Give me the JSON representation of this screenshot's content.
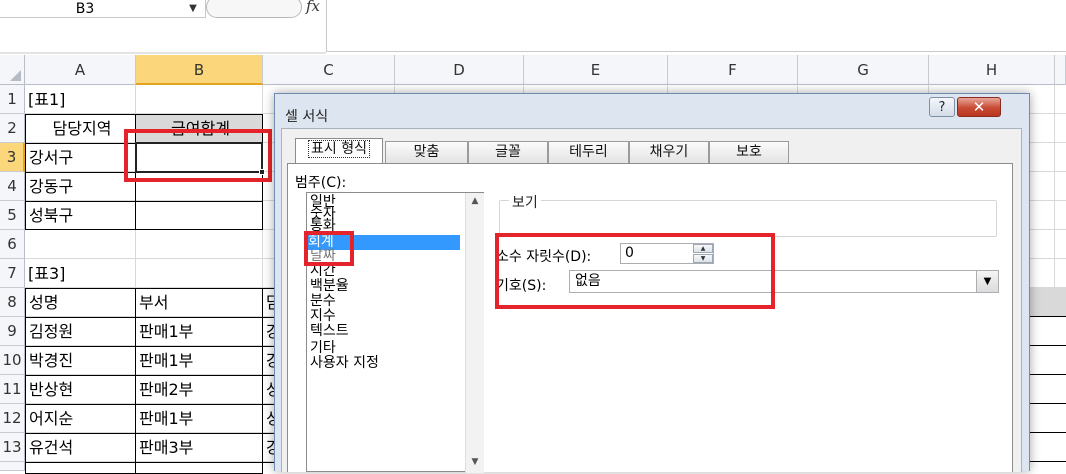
{
  "formula_bar": {
    "name_box": "B3",
    "name_box_arrow": "▼",
    "fx": "fx",
    "value": ""
  },
  "columns": [
    "A",
    "B",
    "C",
    "D",
    "E",
    "F",
    "G",
    "H"
  ],
  "selected_column": "B",
  "rows": [
    "1",
    "2",
    "3",
    "4",
    "5",
    "6",
    "7",
    "8",
    "9",
    "10",
    "11",
    "12",
    "13"
  ],
  "selected_row": "3",
  "cells": {
    "A1": "[표1]",
    "A2": "담당지역",
    "B2": "급여합계",
    "A3": "강서구",
    "A4": "강동구",
    "A5": "성북구",
    "A7": "[표3]",
    "A8": "성명",
    "B8": "부서",
    "A9": "김정원",
    "B9": "판매1부",
    "A10": "박경진",
    "B10": "판매1부",
    "A11": "반상현",
    "B11": "판매2부",
    "A12": "어지순",
    "B12": "판매1부",
    "A13": "유건석",
    "B13": "판매3부",
    "C8": "담",
    "C9": "강",
    "C10": "강",
    "C11": "성",
    "C12": "성",
    "C13": "강"
  },
  "dialog": {
    "title": "셀 서식",
    "help": "?",
    "close": "✕",
    "tabs": [
      {
        "label": "표시 형식",
        "active": true
      },
      {
        "label": "맞춤"
      },
      {
        "label": "글꼴"
      },
      {
        "label": "테두리"
      },
      {
        "label": "채우기"
      },
      {
        "label": "보호"
      }
    ],
    "category_label": "범주(C):",
    "categories": [
      "일반",
      "숫자",
      "통화",
      "회계",
      "날짜",
      "시간",
      "백분율",
      "분수",
      "지수",
      "텍스트",
      "기타",
      "사용자 지정"
    ],
    "selected_category": "회계",
    "preview_label": "보기",
    "decimal_label": "소수 자릿수(D):",
    "decimal_value": "0",
    "symbol_label": "기호(S):",
    "symbol_value": "없음"
  },
  "colors": {
    "highlight": "#e3242b",
    "selection": "#3399ff",
    "selected_header": "#fbd67a"
  }
}
